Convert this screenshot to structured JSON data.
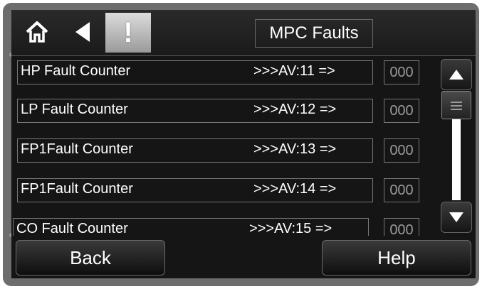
{
  "header": {
    "title": "MPC Faults",
    "buttons": [
      {
        "icon": "home-icon"
      },
      {
        "icon": "back-arrow-icon"
      },
      {
        "icon": "alert-icon",
        "glyph": "!"
      }
    ]
  },
  "rows": [
    {
      "label": "HP Fault Counter",
      "address": ">>>AV:11 =>",
      "value": "000"
    },
    {
      "label": "LP Fault Counter",
      "address": ">>>AV:12 =>",
      "value": "000"
    },
    {
      "label": "FP1Fault Counter",
      "address": ">>>AV:13 =>",
      "value": "000"
    },
    {
      "label": "FP1Fault Counter",
      "address": ">>>AV:14 =>",
      "value": "000"
    },
    {
      "label": "CO Fault Counter",
      "address": ">>>AV:15 =>",
      "value": "000"
    }
  ],
  "scroll": {
    "up_icon": "scroll-up-icon",
    "down_icon": "scroll-down-icon"
  },
  "footer": {
    "back_label": "Back",
    "help_label": "Help"
  },
  "colors": {
    "background": "#151515",
    "frame": "#6d6d6d",
    "text": "#ffffff",
    "value_text": "#9a9a9a"
  }
}
